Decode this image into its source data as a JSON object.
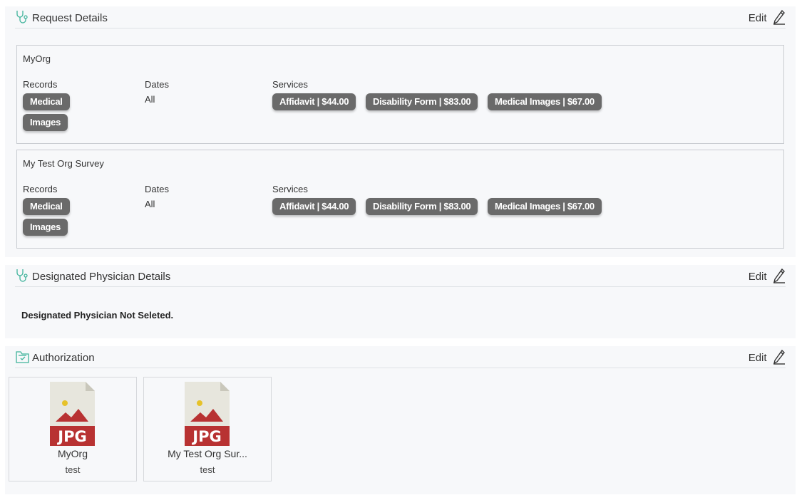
{
  "request_details": {
    "title": "Request Details",
    "edit_label": "Edit",
    "orgs": [
      {
        "name": "MyOrg",
        "records_label": "Records",
        "dates_label": "Dates",
        "services_label": "Services",
        "records": [
          "Medical",
          "Images"
        ],
        "dates": "All",
        "services": [
          "Affidavit | $44.00",
          "Disability Form | $83.00",
          "Medical Images | $67.00"
        ]
      },
      {
        "name": "My Test Org Survey",
        "records_label": "Records",
        "dates_label": "Dates",
        "services_label": "Services",
        "records": [
          "Medical",
          "Images"
        ],
        "dates": "All",
        "services": [
          "Affidavit | $44.00",
          "Disability Form | $83.00",
          "Medical Images | $67.00"
        ]
      }
    ]
  },
  "physician": {
    "title": "Designated Physician Details",
    "edit_label": "Edit",
    "message": "Designated Physician Not Seleted."
  },
  "authorization": {
    "title": "Authorization",
    "edit_label": "Edit",
    "files": [
      {
        "badge": "JPG",
        "name": "MyOrg",
        "desc": "test"
      },
      {
        "badge": "JPG",
        "name": "My Test Org Sur...",
        "desc": "test"
      }
    ]
  },
  "colors": {
    "accent": "#3fb39b",
    "pill": "#6a6a6a",
    "jpg_red": "#b83232",
    "panel_bg": "#f7f8fa"
  },
  "icons": {
    "request": "stethoscope-icon",
    "physician": "stethoscope-icon",
    "authorization": "folder-check-icon",
    "edit": "pencil-icon",
    "file": "jpg-file-icon"
  }
}
